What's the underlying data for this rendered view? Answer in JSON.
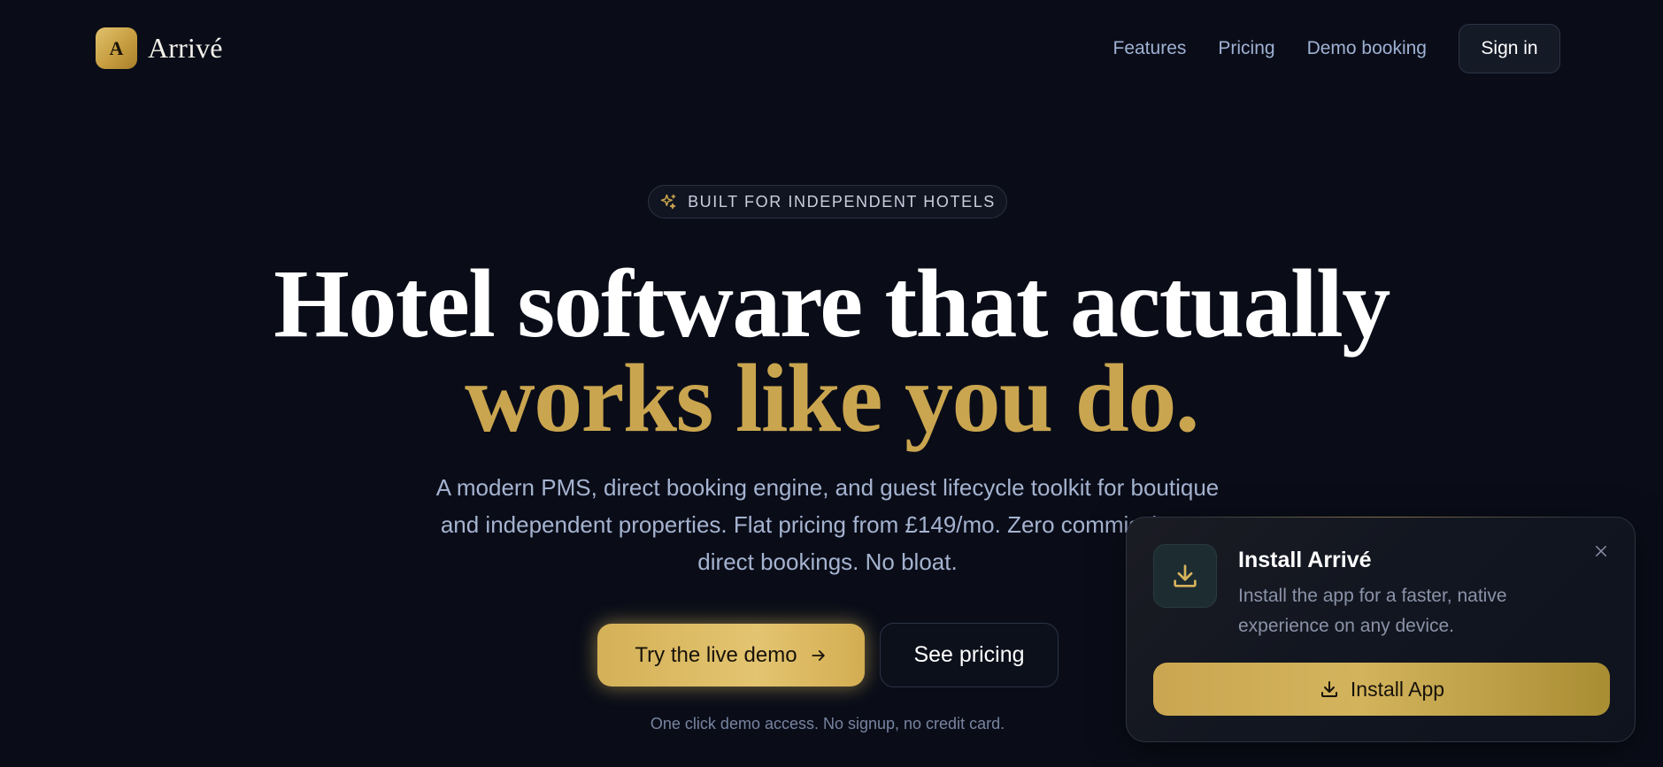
{
  "header": {
    "logo_mark": "A",
    "logo_text": "Arrivé",
    "nav": [
      {
        "label": "Features"
      },
      {
        "label": "Pricing"
      },
      {
        "label": "Demo booking"
      }
    ],
    "signin_label": "Sign in"
  },
  "hero": {
    "badge_icon": "sparkle-icon",
    "badge_text": "BUILT FOR INDEPENDENT HOTELS",
    "title_line1": "Hotel software that actually",
    "title_line2": "works like you do.",
    "subtitle_line1": "A modern PMS, direct booking engine, and guest lifecycle toolkit for boutique",
    "subtitle_line2": "and independent properties. Flat pricing from £149/mo. Zero commission on",
    "subtitle_line3": "direct bookings. No bloat.",
    "cta_primary": "Try the live demo",
    "cta_primary_icon": "arrow-right-icon",
    "cta_secondary": "See pricing",
    "note": "One click demo access. No signup, no credit card."
  },
  "install_prompt": {
    "icon": "download-icon",
    "title": "Install Arrivé",
    "description": "Install the app for a faster, native experience on any device.",
    "close_icon": "close-icon",
    "button_label": "Install App",
    "button_icon": "download-icon"
  },
  "colors": {
    "background": "#0a0d18",
    "accent_gold": "#caa54f",
    "nav_text": "#9fb1d3",
    "subtitle_text": "#a5b3d0"
  }
}
